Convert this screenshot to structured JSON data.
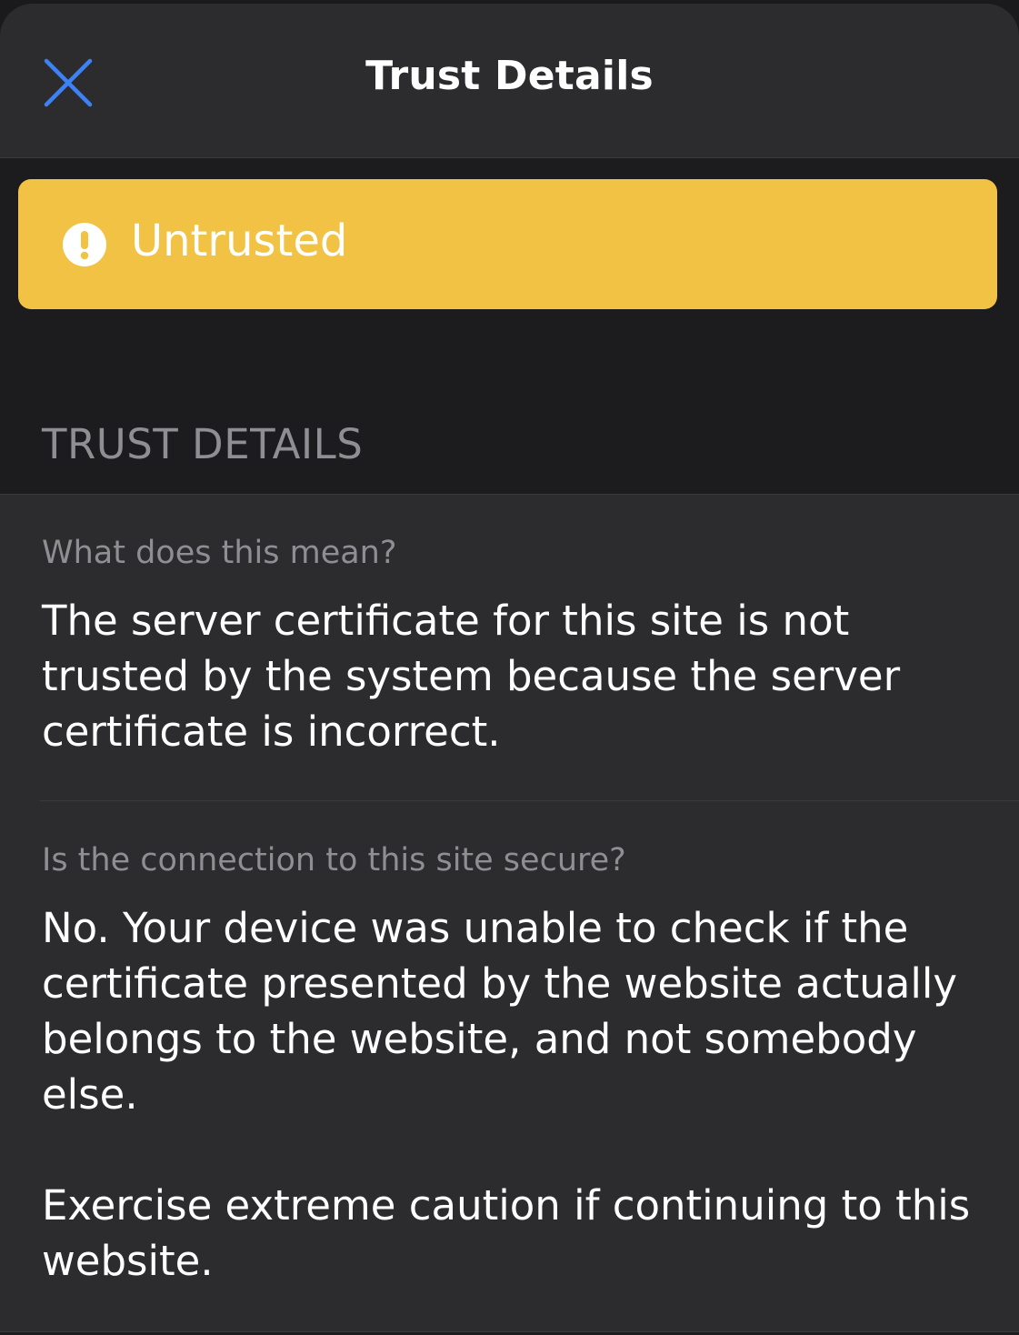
{
  "navbar": {
    "title": "Trust Details",
    "close_icon": "close-x-icon",
    "accent_color": "#3b82f6"
  },
  "banner": {
    "status_text": "Untrusted",
    "icon": "exclamation-circle-icon",
    "color": "#f2c244"
  },
  "section": {
    "header": "TRUST DETAILS",
    "items": [
      {
        "question": "What does this mean?",
        "answer": "The server certificate for this site is not trusted by the system because the server certificate is incorrect."
      },
      {
        "question": "Is the connection to this site secure?",
        "answer": "No. Your device was unable to check if the certificate presented by the website actually belongs to the website, and not somebody else.",
        "answer_extra": "Exercise extreme caution if continuing to this website."
      }
    ]
  }
}
